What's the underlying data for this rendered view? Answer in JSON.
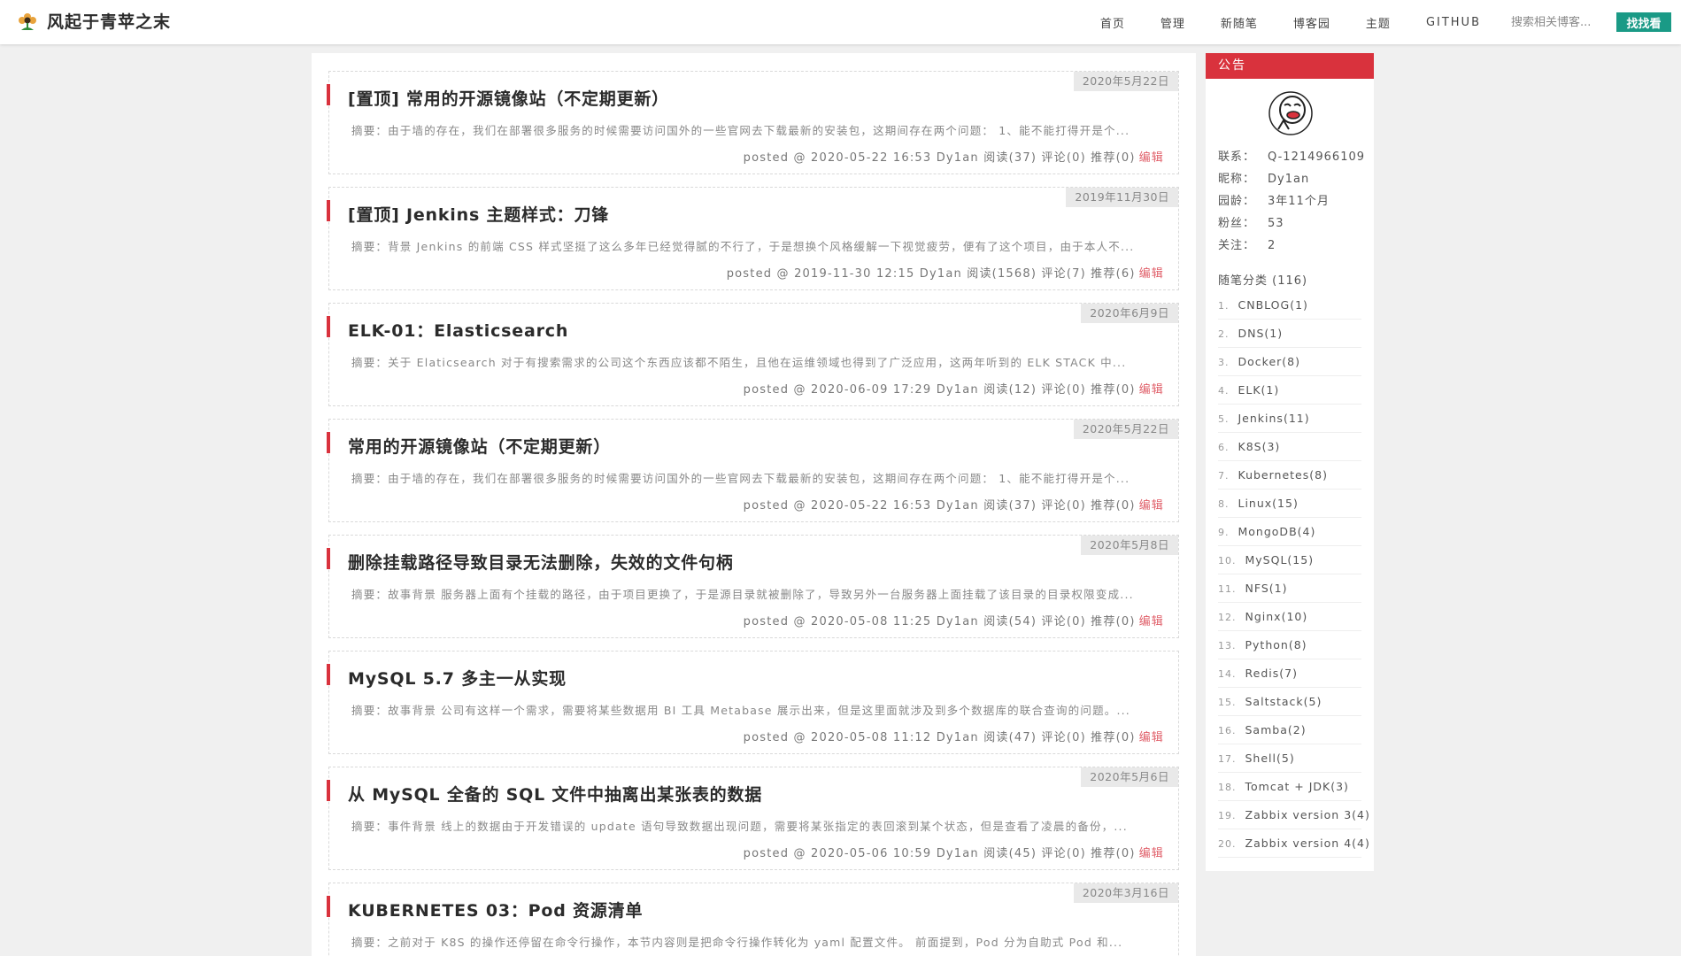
{
  "header": {
    "site_title": "风起于青苹之末",
    "nav": [
      "首页",
      "管理",
      "新随笔",
      "博客园",
      "主题",
      "GITHUB"
    ],
    "search_placeholder": "搜索相关博客...",
    "search_button": "找找看"
  },
  "posts": [
    {
      "date": "2020年5月22日",
      "title": "[置顶] 常用的开源镜像站（不定期更新）",
      "summary": "摘要：由于墙的存在，我们在部署很多服务的时候需要访问国外的一些官网去下载最新的安装包，这期间存在两个问题： 1、能不能打得开是个...",
      "meta": "posted @ 2020-05-22 16:53 Dy1an 阅读(37) 评论(0) 推荐(0)",
      "edit": "编辑"
    },
    {
      "date": "2019年11月30日",
      "title": "[置顶] Jenkins 主题样式：刀锋",
      "summary": "摘要：背景 Jenkins 的前端 CSS 样式坚挺了这么多年已经觉得腻的不行了，于是想换个风格缓解一下视觉疲劳，便有了这个项目，由于本人不...",
      "meta": "posted @ 2019-11-30 12:15 Dy1an 阅读(1568) 评论(7) 推荐(6)",
      "edit": "编辑"
    },
    {
      "date": "2020年6月9日",
      "title": "ELK-01：Elasticsearch",
      "summary": "摘要：关于 Elaticsearch 对于有搜索需求的公司这个东西应该都不陌生，且他在运维领域也得到了广泛应用，这两年听到的 ELK STACK 中...",
      "meta": "posted @ 2020-06-09 17:29 Dy1an 阅读(12) 评论(0) 推荐(0)",
      "edit": "编辑"
    },
    {
      "date": "2020年5月22日",
      "title": "常用的开源镜像站（不定期更新）",
      "summary": "摘要：由于墙的存在，我们在部署很多服务的时候需要访问国外的一些官网去下载最新的安装包，这期间存在两个问题： 1、能不能打得开是个...",
      "meta": "posted @ 2020-05-22 16:53 Dy1an 阅读(37) 评论(0) 推荐(0)",
      "edit": "编辑"
    },
    {
      "date": "2020年5月8日",
      "title": "删除挂载路径导致目录无法删除，失效的文件句柄",
      "summary": "摘要：故事背景 服务器上面有个挂载的路径，由于项目更换了，于是源目录就被删除了，导致另外一台服务器上面挂载了该目录的目录权限变成...",
      "meta": "posted @ 2020-05-08 11:25 Dy1an 阅读(54) 评论(0) 推荐(0)",
      "edit": "编辑"
    },
    {
      "date": "",
      "title": "MySQL 5.7 多主一从实现",
      "summary": "摘要：故事背景 公司有这样一个需求，需要将某些数据用 BI 工具 Metabase 展示出来，但是这里面就涉及到多个数据库的联合查询的问题。...",
      "meta": "posted @ 2020-05-08 11:12 Dy1an 阅读(47) 评论(0) 推荐(0)",
      "edit": "编辑"
    },
    {
      "date": "2020年5月6日",
      "title": "从 MySQL 全备的 SQL 文件中抽离出某张表的数据",
      "summary": "摘要：事件背景 线上的数据由于开发错误的 update 语句导致数据出现问题，需要将某张指定的表回滚到某个状态，但是查看了凌晨的备份，...",
      "meta": "posted @ 2020-05-06 10:59 Dy1an 阅读(45) 评论(0) 推荐(0)",
      "edit": "编辑"
    },
    {
      "date": "2020年3月16日",
      "title": "KUBERNETES 03：Pod 资源清单",
      "summary": "摘要：之前对于 K8S 的操作还停留在命令行操作，本节内容则是把命令行操作转化为 yaml 配置文件。 前面提到，Pod 分为自助式 Pod 和...",
      "meta": "",
      "edit": ""
    }
  ],
  "sidebar": {
    "title": "公告",
    "info": [
      {
        "k": "联系：",
        "v": "Q-1214966109"
      },
      {
        "k": "昵称：",
        "v": "Dy1an"
      },
      {
        "k": "园龄：",
        "v": "3年11个月"
      },
      {
        "k": "粉丝：",
        "v": "53"
      },
      {
        "k": "关注：",
        "v": "2"
      }
    ],
    "category_title": "随笔分类 (116)",
    "categories": [
      {
        "n": "1.",
        "name": "CNBLOG(1)"
      },
      {
        "n": "2.",
        "name": "DNS(1)"
      },
      {
        "n": "3.",
        "name": "Docker(8)"
      },
      {
        "n": "4.",
        "name": "ELK(1)"
      },
      {
        "n": "5.",
        "name": "Jenkins(11)"
      },
      {
        "n": "6.",
        "name": "K8S(3)"
      },
      {
        "n": "7.",
        "name": "Kubernetes(8)"
      },
      {
        "n": "8.",
        "name": "Linux(15)"
      },
      {
        "n": "9.",
        "name": "MongoDB(4)"
      },
      {
        "n": "10.",
        "name": "MySQL(15)"
      },
      {
        "n": "11.",
        "name": "NFS(1)"
      },
      {
        "n": "12.",
        "name": "Nginx(10)"
      },
      {
        "n": "13.",
        "name": "Python(8)"
      },
      {
        "n": "14.",
        "name": "Redis(7)"
      },
      {
        "n": "15.",
        "name": "Saltstack(5)"
      },
      {
        "n": "16.",
        "name": "Samba(2)"
      },
      {
        "n": "17.",
        "name": "Shell(5)"
      },
      {
        "n": "18.",
        "name": "Tomcat + JDK(3)"
      },
      {
        "n": "19.",
        "name": "Zabbix version 3(4)"
      },
      {
        "n": "20.",
        "name": "Zabbix version 4(4)"
      }
    ]
  },
  "colors": {
    "accent": "#d9323d",
    "search_button": "#1a9a86",
    "edit_link": "#e0606a"
  }
}
